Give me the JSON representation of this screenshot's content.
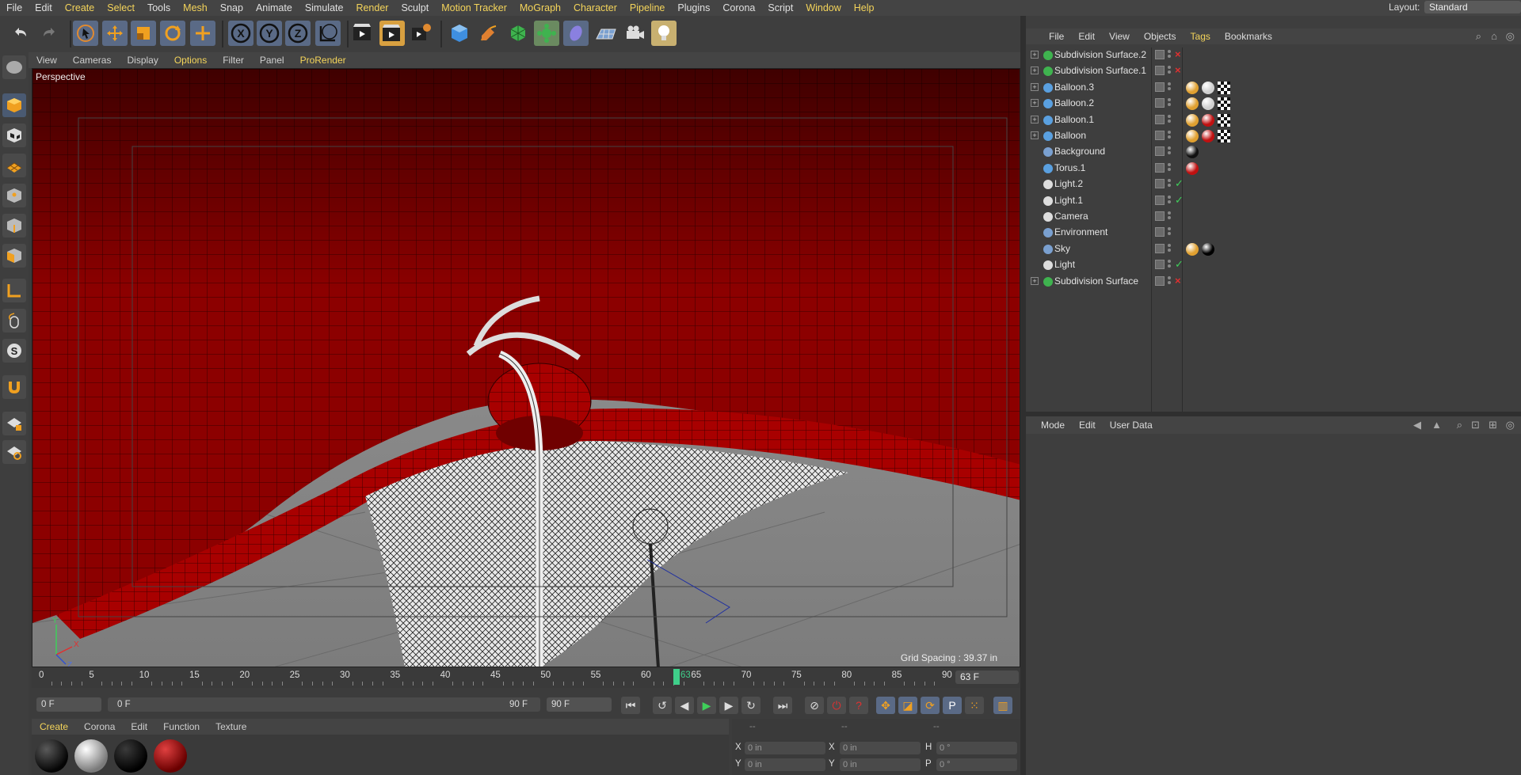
{
  "menubar": {
    "items": [
      "File",
      "Edit",
      "Create",
      "Select",
      "Tools",
      "Mesh",
      "Snap",
      "Animate",
      "Simulate",
      "Render",
      "Sculpt",
      "Motion Tracker",
      "MoGraph",
      "Character",
      "Pipeline",
      "Plugins",
      "Corona",
      "Script",
      "Window",
      "Help"
    ],
    "highlighted": [
      2,
      3,
      5,
      9,
      11,
      12,
      13,
      14,
      18,
      19
    ]
  },
  "layout": {
    "label": "Layout:",
    "value": "Standard"
  },
  "toolbar": {
    "icons": [
      "undo-icon",
      "redo-icon",
      "select-cursor-icon",
      "move-icon",
      "scale-icon",
      "rotate-icon",
      "move-alt-icon",
      "x-axis-icon",
      "y-axis-icon",
      "z-axis-icon",
      "coordinate-system-icon",
      "render-view-icon",
      "render-picture-viewer-icon",
      "render-settings-icon",
      "cube-icon",
      "pen-icon",
      "subdivision-icon",
      "cloner-icon",
      "deformer-icon",
      "floor-icon",
      "camera-icon",
      "light-icon"
    ],
    "axis_x": "X",
    "axis_y": "Y",
    "axis_z": "Z"
  },
  "viewport": {
    "menu": [
      "View",
      "Cameras",
      "Display",
      "Options",
      "Filter",
      "Panel",
      "ProRender"
    ],
    "highlighted": [
      3,
      6
    ],
    "camera_label": "Perspective",
    "grid_spacing": "Grid Spacing : 39.37 in",
    "axis_labels": {
      "y": "Y",
      "x": "X",
      "z": "Z"
    }
  },
  "timeline": {
    "ticks": [
      "0",
      "5",
      "10",
      "15",
      "20",
      "25",
      "30",
      "35",
      "40",
      "45",
      "50",
      "55",
      "60",
      "65",
      "70",
      "75",
      "80",
      "85",
      "90"
    ],
    "playhead_label": "63",
    "current_frame": "63 F"
  },
  "playback": {
    "start_field": "0 F",
    "range_start": "0 F",
    "range_end": "90 F",
    "end_field": "90 F"
  },
  "material_manager": {
    "menu": [
      "Create",
      "Corona",
      "Edit",
      "Function",
      "Texture"
    ],
    "highlighted": [
      0
    ],
    "materials": [
      {
        "color_a": "#5a5a5a",
        "color_b": "#050505"
      },
      {
        "color_a": "#ffffff",
        "color_b": "#7a7a7a"
      },
      {
        "color_a": "#3a3a3a",
        "color_b": "#000000"
      },
      {
        "color_a": "#e04040",
        "color_b": "#6a0000"
      }
    ]
  },
  "coordinates": {
    "headers": [
      "--",
      "--",
      "--"
    ],
    "rows": [
      {
        "l1": "X",
        "v1": "0 in",
        "l2": "X",
        "v2": "0 in",
        "l3": "H",
        "v3": "0 °"
      },
      {
        "l1": "Y",
        "v1": "0 in",
        "l2": "Y",
        "v2": "0 in",
        "l3": "P",
        "v3": "0 °"
      }
    ]
  },
  "object_manager": {
    "menu": [
      "File",
      "Edit",
      "View",
      "Objects",
      "Tags",
      "Bookmarks"
    ],
    "highlighted": [
      4
    ],
    "objects": [
      {
        "name": "Subdivision Surface.2",
        "icon": "#3fb34f",
        "expand": true,
        "status": "x",
        "tags": []
      },
      {
        "name": "Subdivision Surface.1",
        "icon": "#3fb34f",
        "expand": true,
        "status": "x",
        "tags": []
      },
      {
        "name": "Balloon.3",
        "icon": "#5aa0e0",
        "expand": true,
        "status": "",
        "tags": [
          "#e0a030",
          "#cfcfcf",
          "check"
        ]
      },
      {
        "name": "Balloon.2",
        "icon": "#5aa0e0",
        "expand": true,
        "status": "",
        "tags": [
          "#e0a030",
          "#cfcfcf",
          "check"
        ]
      },
      {
        "name": "Balloon.1",
        "icon": "#5aa0e0",
        "expand": true,
        "status": "",
        "tags": [
          "#e0a030",
          "#c01010",
          "check"
        ]
      },
      {
        "name": "Balloon",
        "icon": "#5aa0e0",
        "expand": true,
        "status": "",
        "tags": [
          "#e0a030",
          "#c01010",
          "check"
        ]
      },
      {
        "name": "Background",
        "icon": "#7aa0d0",
        "expand": false,
        "status": "",
        "tags": [
          "#111111"
        ]
      },
      {
        "name": "Torus.1",
        "icon": "#5aa0e0",
        "expand": false,
        "status": "",
        "tags": [
          "#c01010"
        ]
      },
      {
        "name": "Light.2",
        "icon": "#dddddd",
        "expand": false,
        "status": "check",
        "tags": []
      },
      {
        "name": "Light.1",
        "icon": "#dddddd",
        "expand": false,
        "status": "check",
        "tags": []
      },
      {
        "name": "Camera",
        "icon": "#dddddd",
        "expand": false,
        "status": "",
        "tags": []
      },
      {
        "name": "Environment",
        "icon": "#7aa0d0",
        "expand": false,
        "status": "",
        "tags": []
      },
      {
        "name": "Sky",
        "icon": "#7aa0d0",
        "expand": false,
        "status": "",
        "tags": [
          "#e0a030",
          "#000000"
        ]
      },
      {
        "name": "Light",
        "icon": "#dddddd",
        "expand": false,
        "status": "check",
        "tags": []
      },
      {
        "name": "Subdivision Surface",
        "icon": "#3fb34f",
        "expand": true,
        "status": "x",
        "tags": []
      }
    ]
  },
  "attribute_manager": {
    "menu": [
      "Mode",
      "Edit",
      "User Data"
    ]
  },
  "colors": {
    "accent": "#f4d45a",
    "balloon_red": "#9a0000",
    "status_red": "#e03030",
    "status_green": "#3fcf5a"
  }
}
